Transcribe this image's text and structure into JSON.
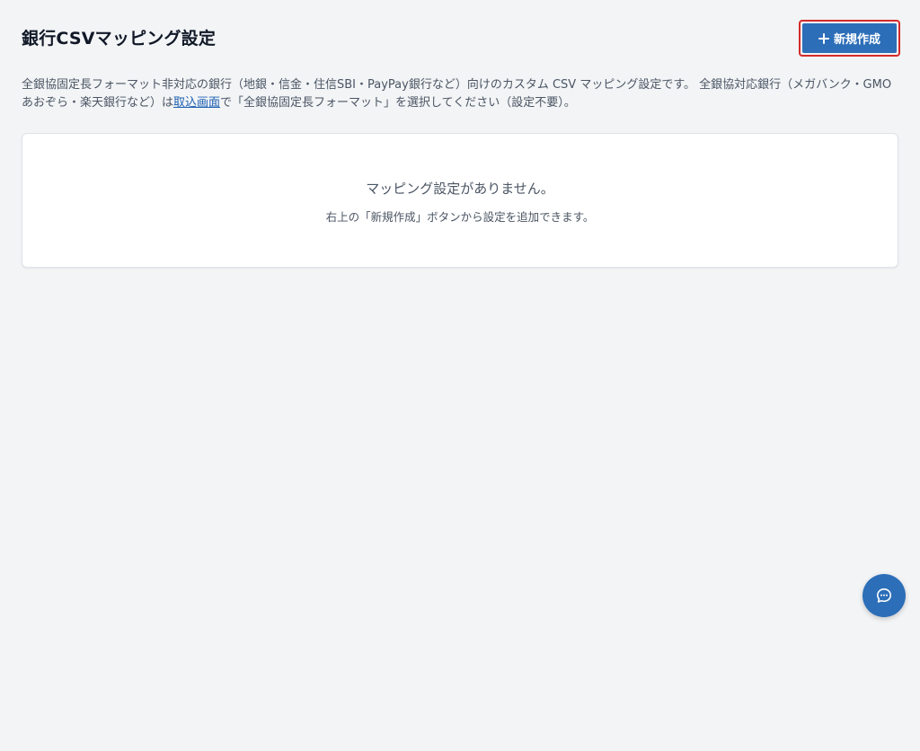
{
  "header": {
    "title": "銀行CSVマッピング設定",
    "new_button_label": "新規作成",
    "new_button_icon": "plus-icon"
  },
  "description": {
    "part1": "全銀協固定長フォーマット非対応の銀行（地銀・信金・住信SBI・PayPay銀行など）向けのカスタム CSV マッピング設定です。 全銀協対応銀行（メガバンク・GMOあおぞら・楽天銀行など）は",
    "link_text": "取込画面",
    "part2": "で「全銀協固定長フォーマット」を選択してください（設定不要）。"
  },
  "empty_state": {
    "title": "マッピング設定がありません。",
    "subtitle": "右上の「新規作成」ボタンから設定を追加できます。"
  },
  "chat": {
    "icon": "chat-bubble-icon"
  },
  "colors": {
    "accent": "#2c6eb8",
    "highlight_border": "#d42a2a",
    "background": "#f2f4f6",
    "link": "#1d5fb0"
  }
}
